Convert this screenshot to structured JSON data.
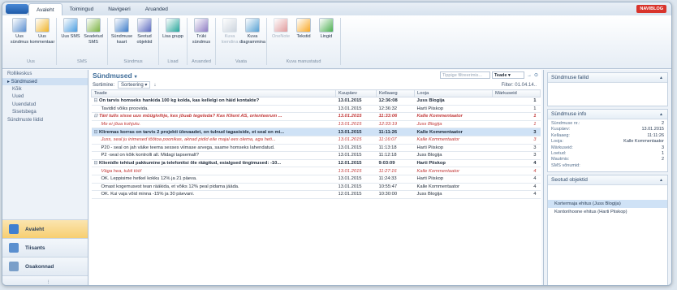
{
  "tabs": {
    "app_button": "",
    "items": [
      "Avaleht",
      "Toimingud",
      "Navigeeri",
      "Aruanded"
    ],
    "brand": "NAVIBLOG"
  },
  "ribbon": {
    "groups": [
      {
        "label": "Uus",
        "buttons": [
          {
            "label": "Uus sündmus",
            "icon": "new-event-icon",
            "disabled": false
          },
          {
            "label": "Uus kommentaar",
            "icon": "new-comment-icon",
            "disabled": false
          }
        ]
      },
      {
        "label": "SMS",
        "buttons": [
          {
            "label": "Uus SMS",
            "icon": "new-sms-icon",
            "disabled": false
          },
          {
            "label": "Seadetud SMS",
            "icon": "sms-settings-icon",
            "disabled": false
          }
        ]
      },
      {
        "label": "Sündmus",
        "buttons": [
          {
            "label": "Sündmuse kaart",
            "icon": "event-card-icon",
            "disabled": false
          },
          {
            "label": "Seotud objektid",
            "icon": "related-objects-icon",
            "disabled": false
          }
        ]
      },
      {
        "label": "Lisad",
        "buttons": [
          {
            "label": "Lisa grupp",
            "icon": "add-group-icon",
            "disabled": false
          }
        ]
      },
      {
        "label": "Aruanded",
        "buttons": [
          {
            "label": "Trüki sündmus",
            "icon": "print-event-icon",
            "disabled": false
          }
        ]
      },
      {
        "label": "Vaata",
        "buttons": [
          {
            "label": "Kuva loendina",
            "icon": "list-view-icon",
            "disabled": true
          },
          {
            "label": "Kuva diagrammina",
            "icon": "chart-view-icon",
            "disabled": false
          }
        ]
      },
      {
        "label": "Kuva manustatud",
        "buttons": [
          {
            "label": "OneNote",
            "icon": "onenote-icon",
            "disabled": true
          },
          {
            "label": "Tekstid",
            "icon": "texts-icon",
            "disabled": false
          },
          {
            "label": "Lingid",
            "icon": "links-icon",
            "disabled": false
          }
        ]
      }
    ]
  },
  "leftnav": {
    "items": [
      {
        "label": "Rollikeskus",
        "sel": false,
        "sub": false
      },
      {
        "label": "▸ Sündmused",
        "sel": true,
        "sub": false
      },
      {
        "label": "Kõik",
        "sel": false,
        "sub": true
      },
      {
        "label": "Uued",
        "sel": false,
        "sub": true
      },
      {
        "label": "Uuendatud",
        "sel": false,
        "sub": true
      },
      {
        "label": "Sisetsbega",
        "sel": false,
        "sub": true
      },
      {
        "label": "Sündmuste liidid",
        "sel": false,
        "sub": false
      }
    ],
    "buttons": [
      {
        "label": "Avaleht",
        "sel": true
      },
      {
        "label": "Tiisants",
        "sel": false
      },
      {
        "label": "Osakonnad",
        "sel": false
      }
    ],
    "more": "⁝"
  },
  "main": {
    "title": "Sündmused",
    "title_arrow": "▾",
    "search_placeholder": "Tippige filtreerimis...",
    "search_field": "Teade",
    "search_arrow": "▾",
    "search_nav": "→",
    "search_expand": "⊙",
    "sort_label": "Sortimine:",
    "sort_value": "Sorteering ▾",
    "sort_dir": "↓",
    "filter_text": "Filter: 01.04.14..",
    "columns": [
      "Teade",
      "Kuupäev",
      "Kellaaeg",
      "Looja",
      "Märkuseid"
    ],
    "rows": [
      {
        "type": "parent",
        "topic": "On tarvis homseks hankida 100 kg kolda, kas kellelgi on häid kontakte?",
        "date": "13.01.2015",
        "time": "12:36:08",
        "author": "Juss Blogija",
        "count": "1"
      },
      {
        "type": "child",
        "topic": "Tavidid võiks proovida.",
        "date": "13.01.2015",
        "time": "12:36:32",
        "author": "Harti Piiskop",
        "count": "1"
      },
      {
        "type": "parent-red",
        "topic": "Täri tulis sisse uus müügivihje, kes jõuab tegeleda? Kas Klient AS, orienteerum ...",
        "date": "13.01.2015",
        "time": "11:33:06",
        "author": "Kalle Kommentaator",
        "count": "1"
      },
      {
        "type": "comment",
        "topic": "Me ei jõua kohjutu.",
        "date": "13.01.2015",
        "time": "12:33:19",
        "author": "Juss Blogija",
        "count": "1"
      },
      {
        "type": "parent-sel",
        "topic": "Kliremas korras on tarvis 2 projekti ülevaadet, on tulnud tagasiside, et seal on mi...",
        "date": "13.01.2015",
        "time": "11:11:26",
        "author": "Kalle Kommentaator",
        "count": "3"
      },
      {
        "type": "comment",
        "topic": "Juss, seal ju inimesed tõõtoa poonikas, aknad pidid eile majal ees olema, aga heti...",
        "date": "13.01.2015",
        "time": "11:16:07",
        "author": "Kalle Kommentaator",
        "count": "3"
      },
      {
        "type": "child",
        "topic": "P20 - seal on jah väike teema sesses viimase arvega, saame homseks lahendatud.",
        "date": "13.01.2015",
        "time": "11:13:18",
        "author": "Harti Piiskop",
        "count": "3"
      },
      {
        "type": "child",
        "topic": "P2 -seal on kõik kontrolli all. Midagi tapsemalt?",
        "date": "13.01.2015",
        "time": "11:12:18",
        "author": "Juss Blogija",
        "count": "3"
      },
      {
        "type": "parent",
        "topic": "Klienidle tehtud pakkumine ja telefonitsi õle räägitud, esialgsed tingimused: -10...",
        "date": "12.01.2015",
        "time": "9:03:09",
        "author": "Harti Piiskop",
        "count": "4"
      },
      {
        "type": "comment",
        "topic": "Väga hea, tubli töö!",
        "date": "13.01.2015",
        "time": "11:27:16",
        "author": "Kalle Kommentaator",
        "count": "4"
      },
      {
        "type": "child",
        "topic": "OK. Leppisime hetkel kokku 12% ja 21 päeva.",
        "date": "13.01.2015",
        "time": "11:24:33",
        "author": "Harti Piiskop",
        "count": "4"
      },
      {
        "type": "child",
        "topic": "Omast kogemusest tean rääkida, et võiks 12% peal pidama jääda.",
        "date": "13.01.2015",
        "time": "10:55:47",
        "author": "Kalle Kommentaator",
        "count": "4"
      },
      {
        "type": "child",
        "topic": "OK. Kui vaja võid minna -15% ja 30 päevani.",
        "date": "12.01.2015",
        "time": "10:30:00",
        "author": "Juss Blogija",
        "count": "4"
      }
    ]
  },
  "right": {
    "files_title": "Sündmuse failid",
    "info_title": "Sündmuse info",
    "info": [
      {
        "k": "Sündmuse nr.:",
        "v": "2"
      },
      {
        "k": "Kuupäev:",
        "v": "13.01.2015"
      },
      {
        "k": "Kellaaeg:",
        "v": "11:11:26"
      },
      {
        "k": "Looja:",
        "v": "Kalle Kommentaator"
      },
      {
        "k": "Märkuseid:",
        "v": "3"
      },
      {
        "k": "Loetud:",
        "v": "1"
      },
      {
        "k": "Mautmis:",
        "v": "2"
      },
      {
        "k": "SMS võnumid:",
        "v": ""
      }
    ],
    "related_title": "Seotud objektid",
    "related": [
      {
        "label": "Kortermaja ehitus (Juss Blogija)",
        "sel": true
      },
      {
        "label": "Kontorihoone ehitus (Harti Piiskop)",
        "sel": false
      }
    ],
    "caret": "▲"
  }
}
